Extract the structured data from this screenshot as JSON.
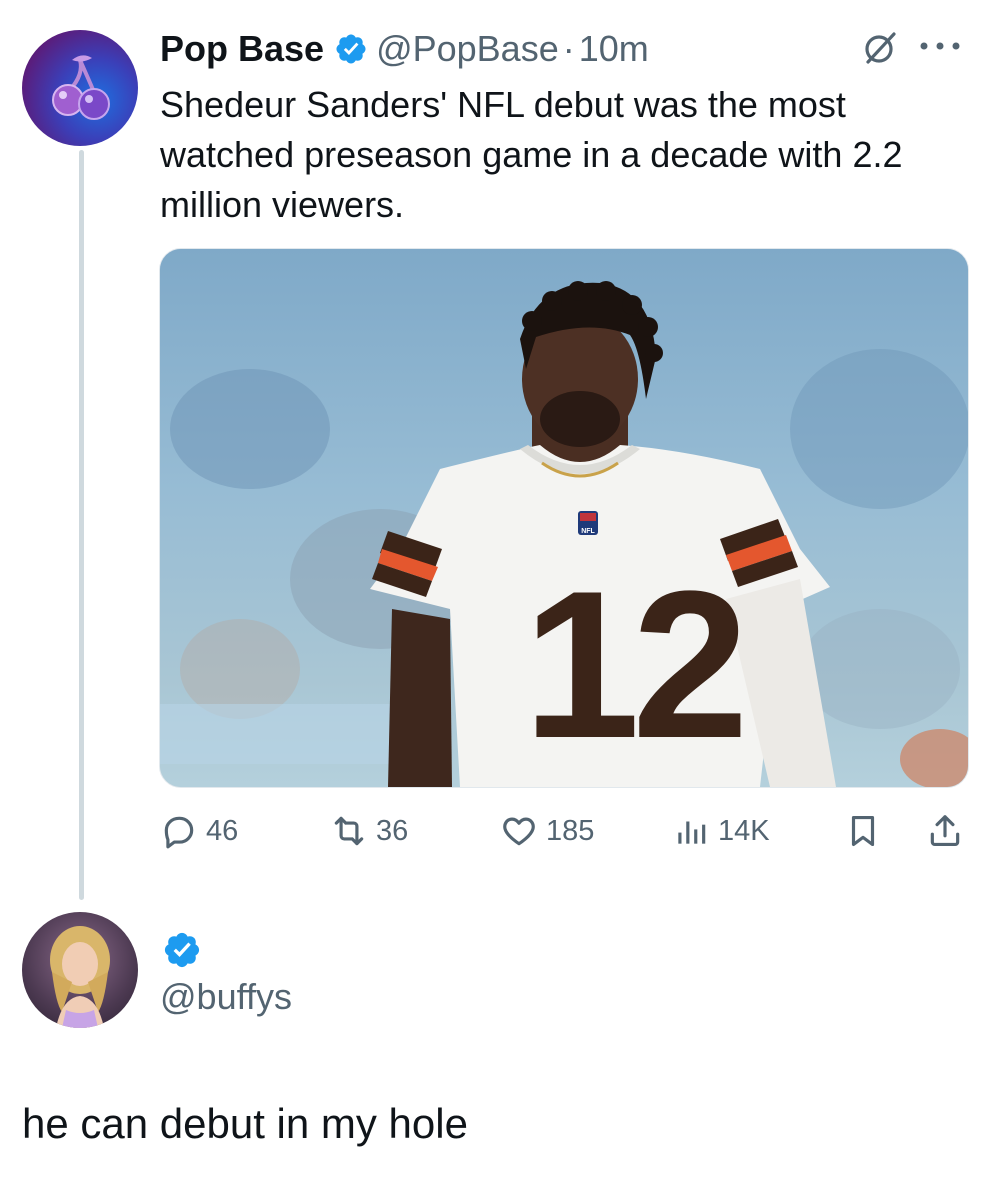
{
  "tweet": {
    "author_name": "Pop Base",
    "handle": "@PopBase",
    "separator": "·",
    "time": "10m",
    "text": "Shedeur Sanders' NFL debut was the most watched preseason game in a decade with 2.2 million viewers.",
    "media": {
      "jersey_number": "12",
      "league_badge": "NFL"
    },
    "stats": {
      "replies": "46",
      "reposts": "36",
      "likes": "185",
      "views": "14K"
    }
  },
  "reply": {
    "handle": "@buffys",
    "text": "he can debut in my hole"
  },
  "colors": {
    "verified": "#1d9bf0",
    "text_primary": "#0f1419",
    "text_secondary": "#536471",
    "thread_line": "#cfd9de",
    "jersey_brown": "#3b2418",
    "jersey_orange": "#e4572e"
  }
}
